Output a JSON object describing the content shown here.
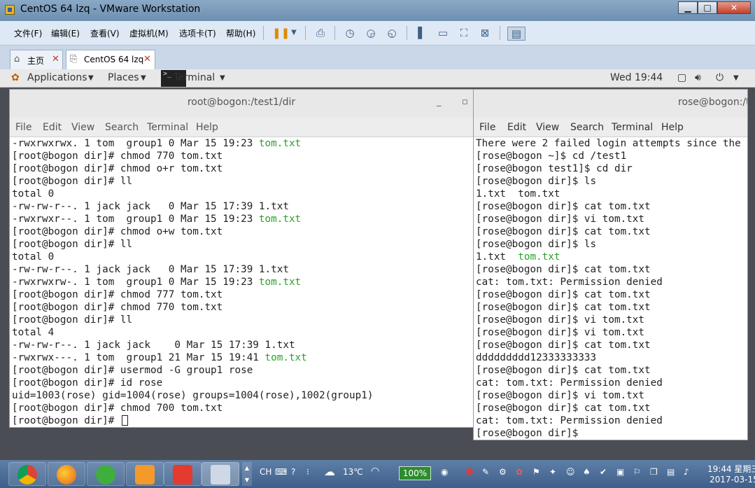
{
  "vmware": {
    "title": "CentOS 64 lzq - VMware Workstation",
    "menu": [
      "文件(F)",
      "编辑(E)",
      "查看(V)",
      "虚拟机(M)",
      "选项卡(T)",
      "帮助(H)"
    ],
    "tabs": [
      {
        "label": "主页",
        "icon": "home-icon"
      },
      {
        "label": "CentOS 64 lzq",
        "icon": "vm-icon"
      }
    ]
  },
  "gnome": {
    "applications": "Applications",
    "places": "Places",
    "terminal": "Terminal",
    "clock": "Wed 19:44"
  },
  "terminal_left": {
    "title": "root@bogon:/test1/dir",
    "menu": [
      "File",
      "Edit",
      "View",
      "Search",
      "Terminal",
      "Help"
    ],
    "lines": [
      {
        "text": "-rwxrwxrwx. 1 tom  group1 0 Mar 15 19:23 ",
        "hl": "tom.txt"
      },
      {
        "text": "[root@bogon dir]# chmod 770 tom.txt"
      },
      {
        "text": "[root@bogon dir]# chmod o+r tom.txt"
      },
      {
        "text": "[root@bogon dir]# ll"
      },
      {
        "text": "total 0"
      },
      {
        "text": "-rw-rw-r--. 1 jack jack   0 Mar 15 17:39 1.txt"
      },
      {
        "text": "-rwxrwxr--. 1 tom  group1 0 Mar 15 19:23 ",
        "hl": "tom.txt"
      },
      {
        "text": "[root@bogon dir]# chmod o+w tom.txt"
      },
      {
        "text": "[root@bogon dir]# ll"
      },
      {
        "text": "total 0"
      },
      {
        "text": "-rw-rw-r--. 1 jack jack   0 Mar 15 17:39 1.txt"
      },
      {
        "text": "-rwxrwxrw-. 1 tom  group1 0 Mar 15 19:23 ",
        "hl": "tom.txt"
      },
      {
        "text": "[root@bogon dir]# chmod 777 tom.txt"
      },
      {
        "text": "[root@bogon dir]# chmod 770 tom.txt"
      },
      {
        "text": "[root@bogon dir]# ll"
      },
      {
        "text": "total 4"
      },
      {
        "text": "-rw-rw-r--. 1 jack jack    0 Mar 15 17:39 1.txt"
      },
      {
        "text": "-rwxrwx---. 1 tom  group1 21 Mar 15 19:41 ",
        "hl": "tom.txt"
      },
      {
        "text": "[root@bogon dir]# usermod -G group1 rose"
      },
      {
        "text": "[root@bogon dir]# id rose"
      },
      {
        "text": "uid=1003(rose) gid=1004(rose) groups=1004(rose),1002(group1)"
      },
      {
        "text": "[root@bogon dir]# chmod 700 tom.txt"
      },
      {
        "text": "[root@bogon dir]# ",
        "cursor": true
      }
    ]
  },
  "terminal_right": {
    "title": "rose@bogon:/te",
    "menu": [
      "File",
      "Edit",
      "View",
      "Search",
      "Terminal",
      "Help"
    ],
    "lines": [
      {
        "text": "There were 2 failed login attempts since the"
      },
      {
        "text": "[rose@bogon ~]$ cd /test1"
      },
      {
        "text": "[rose@bogon test1]$ cd dir"
      },
      {
        "text": "[rose@bogon dir]$ ls"
      },
      {
        "text": "1.txt  tom.txt"
      },
      {
        "text": "[rose@bogon dir]$ cat tom.txt"
      },
      {
        "text": "[rose@bogon dir]$ vi tom.txt"
      },
      {
        "text": "[rose@bogon dir]$ cat tom.txt"
      },
      {
        "text": "[rose@bogon dir]$ ls"
      },
      {
        "text": "1.txt  ",
        "hl": "tom.txt"
      },
      {
        "text": "[rose@bogon dir]$ cat tom.txt"
      },
      {
        "text": "cat: tom.txt: Permission denied"
      },
      {
        "text": "[rose@bogon dir]$ cat tom.txt"
      },
      {
        "text": "[rose@bogon dir]$ cat tom.txt"
      },
      {
        "text": "[rose@bogon dir]$ vi tom.txt"
      },
      {
        "text": "[rose@bogon dir]$ vi tom.txt"
      },
      {
        "text": "[rose@bogon dir]$ cat tom.txt"
      },
      {
        "text": "ddddddddd12333333333"
      },
      {
        "text": "[rose@bogon dir]$ cat tom.txt"
      },
      {
        "text": "cat: tom.txt: Permission denied"
      },
      {
        "text": "[rose@bogon dir]$ vi tom.txt"
      },
      {
        "text": "[rose@bogon dir]$ cat tom.txt"
      },
      {
        "text": "cat: tom.txt: Permission denied"
      },
      {
        "text": "[rose@bogon dir]$"
      }
    ]
  },
  "taskbar": {
    "ime": "CH",
    "weather": "13℃",
    "battery": "100%",
    "time": "19:44 星期三",
    "date": "2017-03-15"
  },
  "colors": {
    "highlight_green": "#2aa12a",
    "vm_chrome": "#dfe9f5",
    "taskbar": "#4a6d98"
  }
}
